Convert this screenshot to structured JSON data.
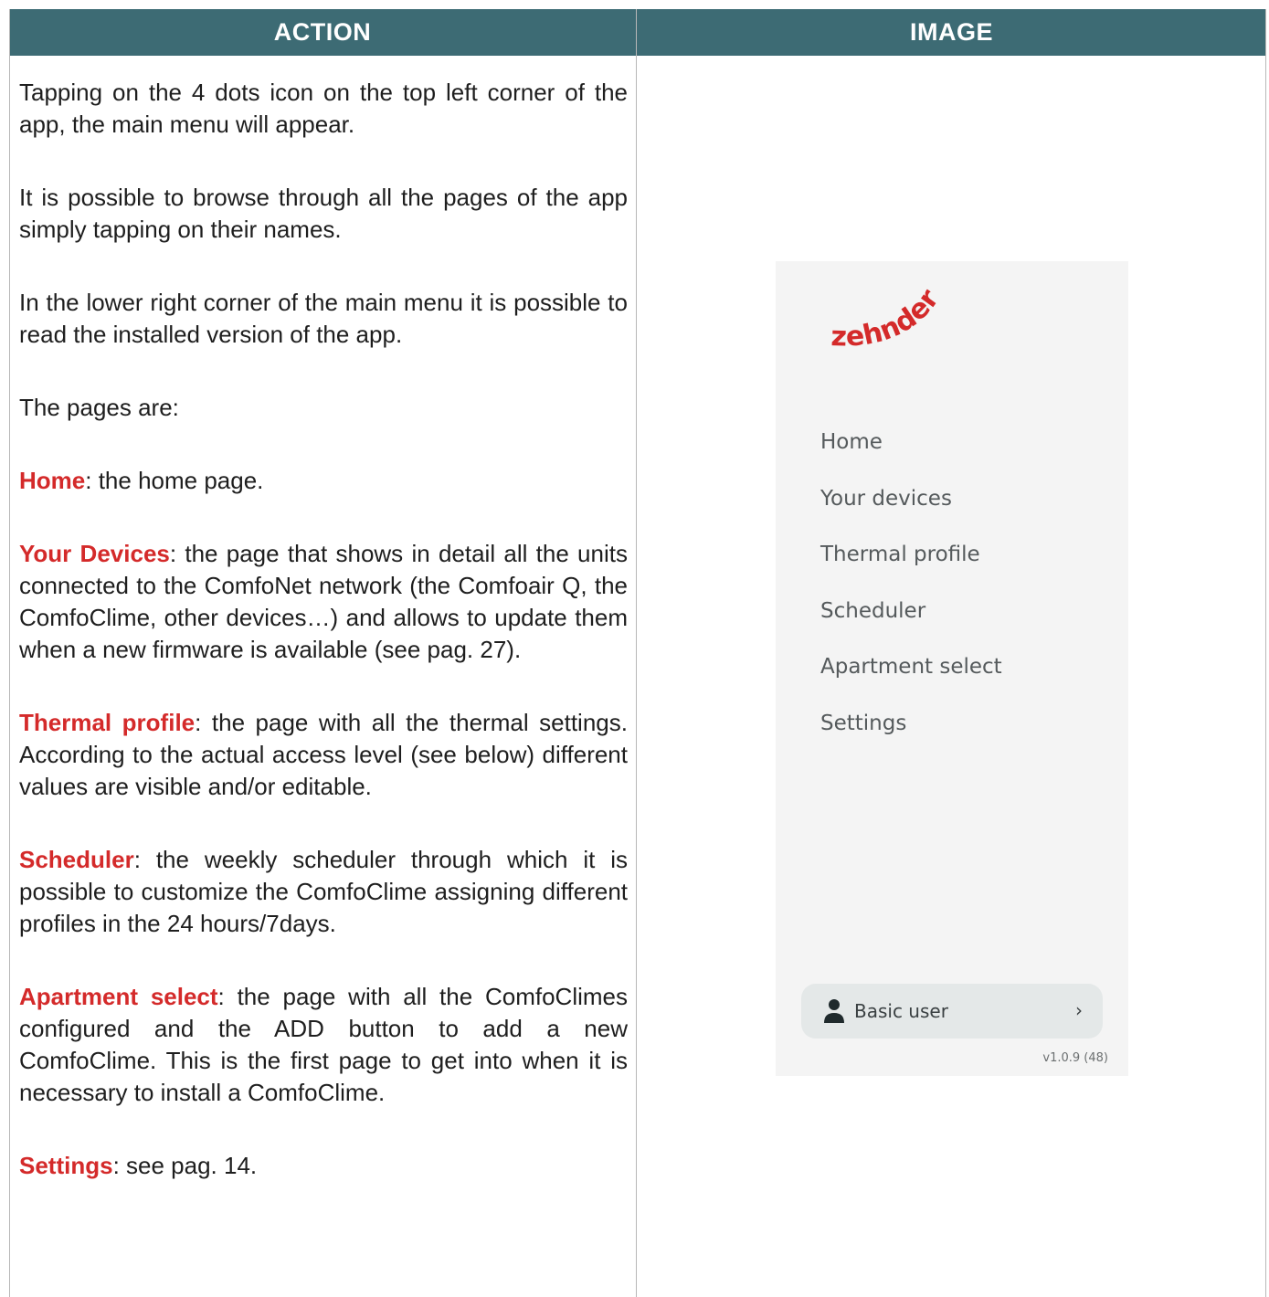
{
  "header": {
    "action": "ACTION",
    "image": "IMAGE"
  },
  "action": {
    "p1": "Tapping on the 4 dots icon on the top left corner of the app, the main menu will appear.",
    "p2": "It is possible to browse through all the pages of the app simply tapping on their names.",
    "p3": "In the lower right corner of the main menu it is possible to read the installed version of the app.",
    "p4": "The pages are:",
    "items": [
      {
        "keyword": "Home",
        "text": ": the home page."
      },
      {
        "keyword": "Your Devices",
        "text": ": the page that shows in detail all the units connected to the ComfoNet network (the Comfoair Q, the ComfoClime, other devices…) and allows to update them when a new firmware is available (see pag. 27)."
      },
      {
        "keyword": "Thermal profile",
        "text": ": the page with all the thermal settings. According to the actual access level (see below) different values are visible and/or editable."
      },
      {
        "keyword": "Scheduler",
        "text": ": the weekly scheduler through which it is possible to customize the ComfoClime assigning different profiles in the 24 hours/7days."
      },
      {
        "keyword": "Apartment select",
        "text": ": the page with all the ComfoClimes configured and the ADD button to add a new ComfoClime. This is the first page to get into when it is necessary to install a ComfoClime."
      },
      {
        "keyword": "Settings",
        "text": ": see pag. 14."
      }
    ]
  },
  "menu": {
    "logo_text": "zehnder",
    "items": [
      "Home",
      "Your devices",
      "Thermal profile",
      "Scheduler",
      "Apartment select",
      "Settings"
    ],
    "user_label": "Basic user",
    "user_icon": "person-icon",
    "chevron": "›",
    "version": "v1.0.9 (48)"
  },
  "colors": {
    "header_bg": "#3d6b74",
    "keyword": "#d42a2a",
    "logo": "#d42a2a",
    "panel_bg": "#f4f4f4",
    "pill_bg": "#e4e8e8"
  }
}
